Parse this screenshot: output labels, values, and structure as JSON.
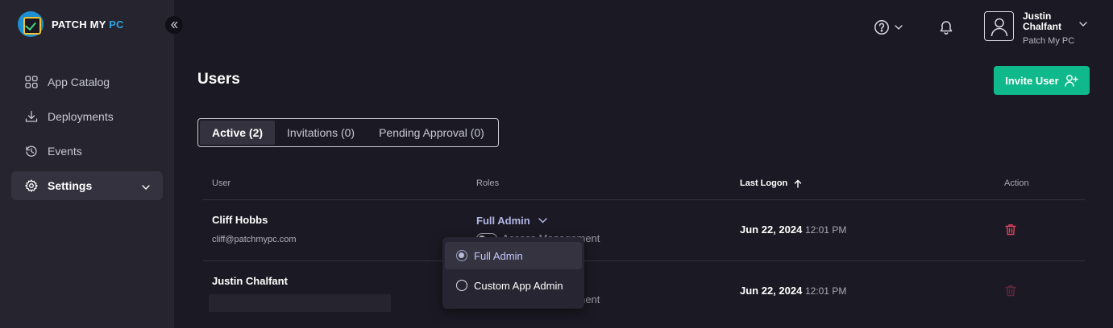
{
  "brand": {
    "name_part1": "PATCH MY ",
    "name_part2": "PC"
  },
  "sidebar": {
    "items": [
      {
        "label": "App Catalog",
        "icon": "grid-icon"
      },
      {
        "label": "Deployments",
        "icon": "download-icon"
      },
      {
        "label": "Events",
        "icon": "history-icon"
      },
      {
        "label": "Settings",
        "icon": "gear-icon",
        "active": true
      }
    ]
  },
  "header": {
    "user_name": "Justin Chalfant",
    "user_org": "Patch My PC"
  },
  "page": {
    "title": "Users",
    "invite_label": "Invite User"
  },
  "tabs": [
    {
      "label": "Active (2)",
      "active": true
    },
    {
      "label": "Invitations (0)"
    },
    {
      "label": "Pending Approval (0)"
    }
  ],
  "table": {
    "headers": {
      "user": "User",
      "roles": "Roles",
      "last_logon": "Last Logon",
      "action": "Action"
    },
    "rows": [
      {
        "name": "Cliff Hobbs",
        "email": "cliff@patchmypc.com",
        "role": "Full Admin",
        "toggle_label": "Access Management",
        "logon_date": "Jun 22, 2024",
        "logon_time": "12:01 PM"
      },
      {
        "name": "Justin Chalfant",
        "email": "",
        "role": "",
        "toggle_label": "Access Management",
        "logon_date": "Jun 22, 2024",
        "logon_time": "12:01 PM"
      }
    ]
  },
  "role_dropdown": {
    "options": [
      {
        "label": "Full Admin",
        "selected": true
      },
      {
        "label": "Custom App Admin",
        "selected": false
      }
    ]
  },
  "colors": {
    "accent": "#10b98b",
    "danger": "#e0405c",
    "role_text": "#b4b6e6"
  }
}
